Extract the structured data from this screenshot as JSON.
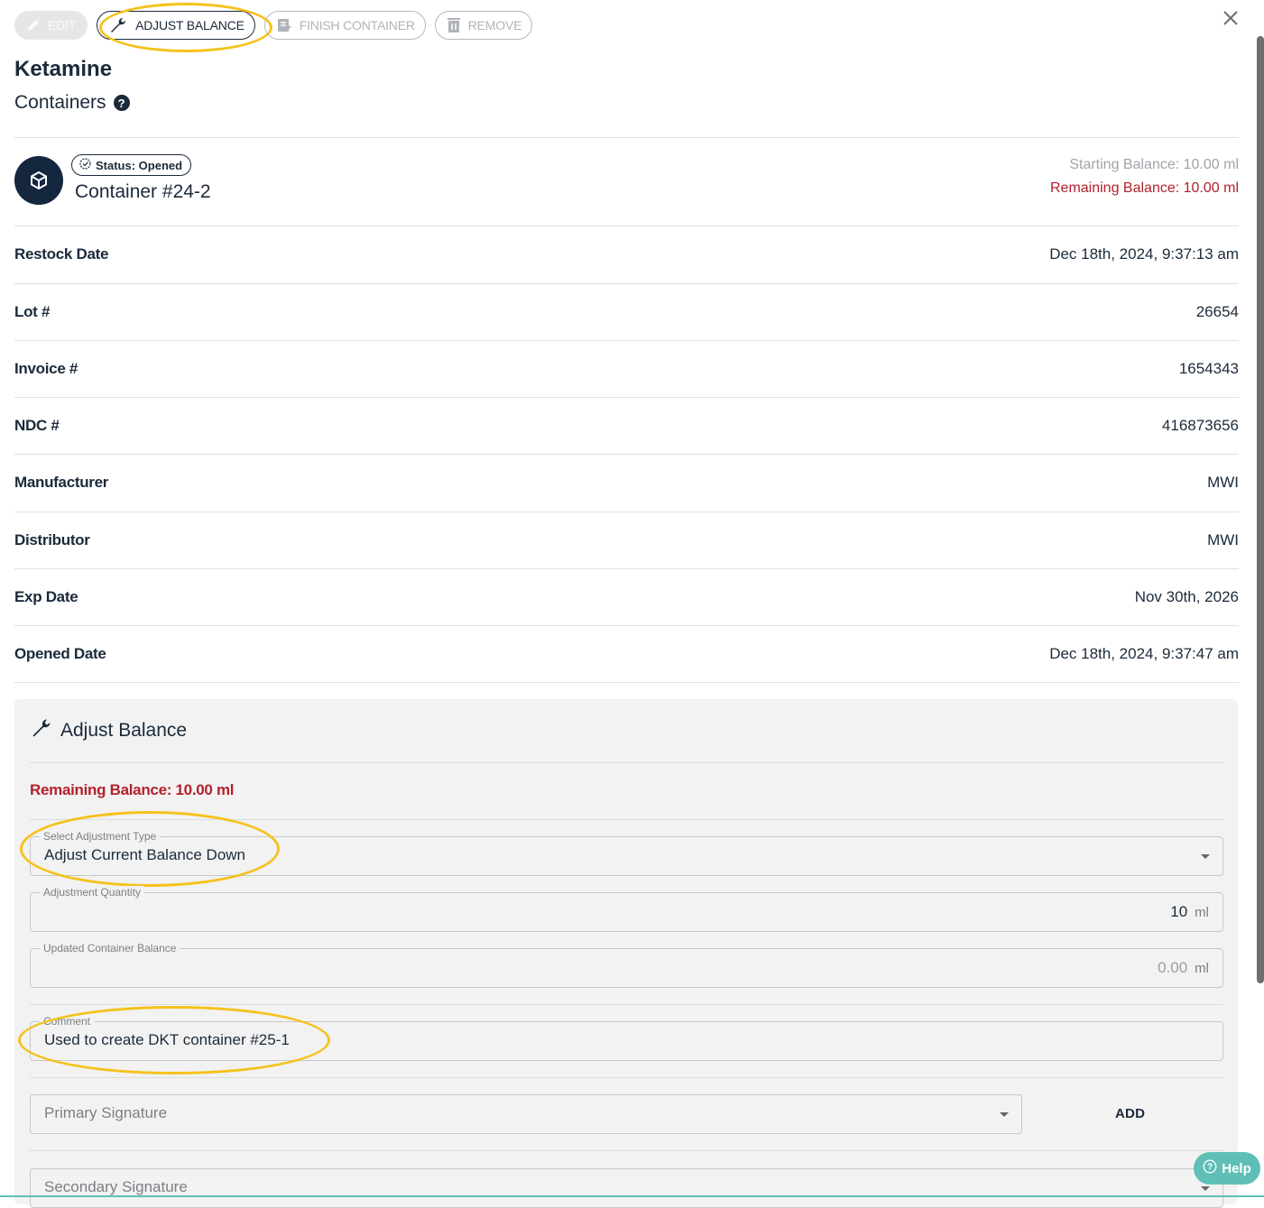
{
  "toolbar": {
    "edit_label": "EDIT",
    "adjust_label": "ADJUST BALANCE",
    "finish_label": "FINISH CONTAINER",
    "remove_label": "REMOVE"
  },
  "header": {
    "title": "Ketamine",
    "subtitle": "Containers"
  },
  "container": {
    "status": "Status: Opened",
    "name": "Container #24-2",
    "starting_balance": "Starting Balance: 10.00 ml",
    "remaining_balance": "Remaining Balance: 10.00 ml"
  },
  "details": [
    {
      "label": "Restock Date",
      "value": "Dec 18th, 2024, 9:37:13 am"
    },
    {
      "label": "Lot #",
      "value": "26654"
    },
    {
      "label": "Invoice #",
      "value": "1654343"
    },
    {
      "label": "NDC #",
      "value": "416873656"
    },
    {
      "label": "Manufacturer",
      "value": "MWI"
    },
    {
      "label": "Distributor",
      "value": "MWI"
    },
    {
      "label": "Exp Date",
      "value": "Nov 30th, 2026"
    },
    {
      "label": "Opened Date",
      "value": "Dec 18th, 2024, 9:37:47 am"
    }
  ],
  "adjust_panel": {
    "title": "Adjust Balance",
    "remaining": "Remaining Balance: 10.00 ml",
    "type_legend": "Select Adjustment Type",
    "type_value": "Adjust Current Balance Down",
    "qty_legend": "Adjustment Quantity",
    "qty_value": "10",
    "qty_unit": "ml",
    "updated_legend": "Updated Container Balance",
    "updated_value": "0.00",
    "updated_unit": "ml",
    "comment_legend": "Comment",
    "comment_value": "Used to create DKT container #25-1",
    "primary_sig_placeholder": "Primary Signature",
    "add_label": "ADD",
    "secondary_sig_placeholder": "Secondary Signature"
  },
  "help": {
    "label": "Help"
  },
  "colors": {
    "navy": "#1b2a3a",
    "alert_red": "#b3212c",
    "highlight": "#f5c21b",
    "help_teal": "#5fbfb7"
  },
  "icons": [
    "pencil-icon",
    "wrench-icon",
    "finish-icon",
    "trash-icon",
    "close-icon",
    "question-icon",
    "box-icon",
    "clock-icon",
    "chevron-down-icon"
  ]
}
